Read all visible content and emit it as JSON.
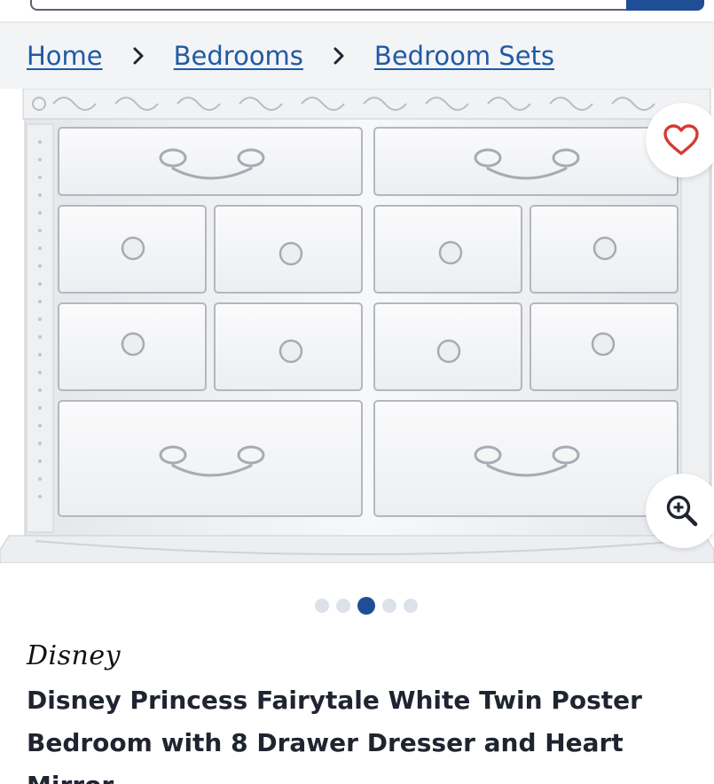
{
  "breadcrumb": {
    "items": [
      "Home",
      "Bedrooms",
      "Bedroom Sets"
    ]
  },
  "product": {
    "brand": "Disney",
    "title": "Disney Princess Fairytale White Twin Poster Bedroom with 8 Drawer Dresser and Heart Mirror",
    "image_subject": "white dresser with 8 drawers"
  },
  "carousel": {
    "total": 5,
    "active_index": 3
  },
  "icons": {
    "favorite": "heart-icon",
    "zoom": "zoom-in-icon",
    "breadcrumb_separator": "chevron-right-icon"
  },
  "colors": {
    "accent": "#1f4e97",
    "link": "#1f5aa5",
    "heart": "#d63a35",
    "dot_inactive": "#dde2ea"
  }
}
